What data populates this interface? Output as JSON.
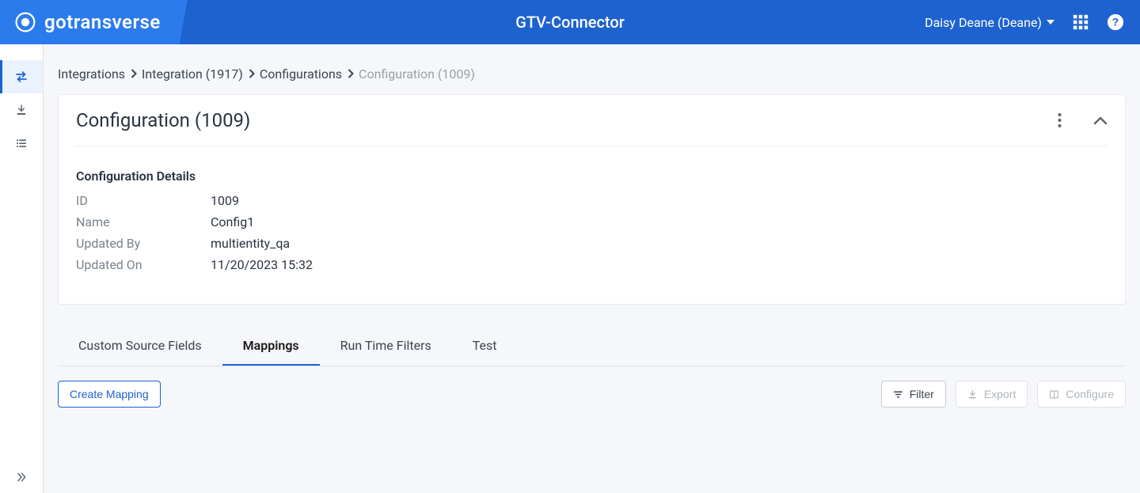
{
  "header": {
    "brand": "gotransverse",
    "title": "GTV-Connector",
    "user": "Daisy Deane (Deane)"
  },
  "breadcrumb": {
    "items": [
      {
        "label": "Integrations",
        "current": false
      },
      {
        "label": "Integration (1917)",
        "current": false
      },
      {
        "label": "Configurations",
        "current": false
      },
      {
        "label": "Configuration (1009)",
        "current": true
      }
    ]
  },
  "card": {
    "title": "Configuration (1009)",
    "section_title": "Configuration Details",
    "details": {
      "id_label": "ID",
      "id_value": "1009",
      "name_label": "Name",
      "name_value": "Config1",
      "updated_by_label": "Updated By",
      "updated_by_value": "multientity_qa",
      "updated_on_label": "Updated On",
      "updated_on_value": "11/20/2023 15:32"
    }
  },
  "tabs": {
    "items": [
      {
        "label": "Custom Source Fields",
        "active": false
      },
      {
        "label": "Mappings",
        "active": true
      },
      {
        "label": "Run Time Filters",
        "active": false
      },
      {
        "label": "Test",
        "active": false
      }
    ]
  },
  "actions": {
    "create_mapping": "Create Mapping",
    "filter": "Filter",
    "export": "Export",
    "configure": "Configure"
  }
}
